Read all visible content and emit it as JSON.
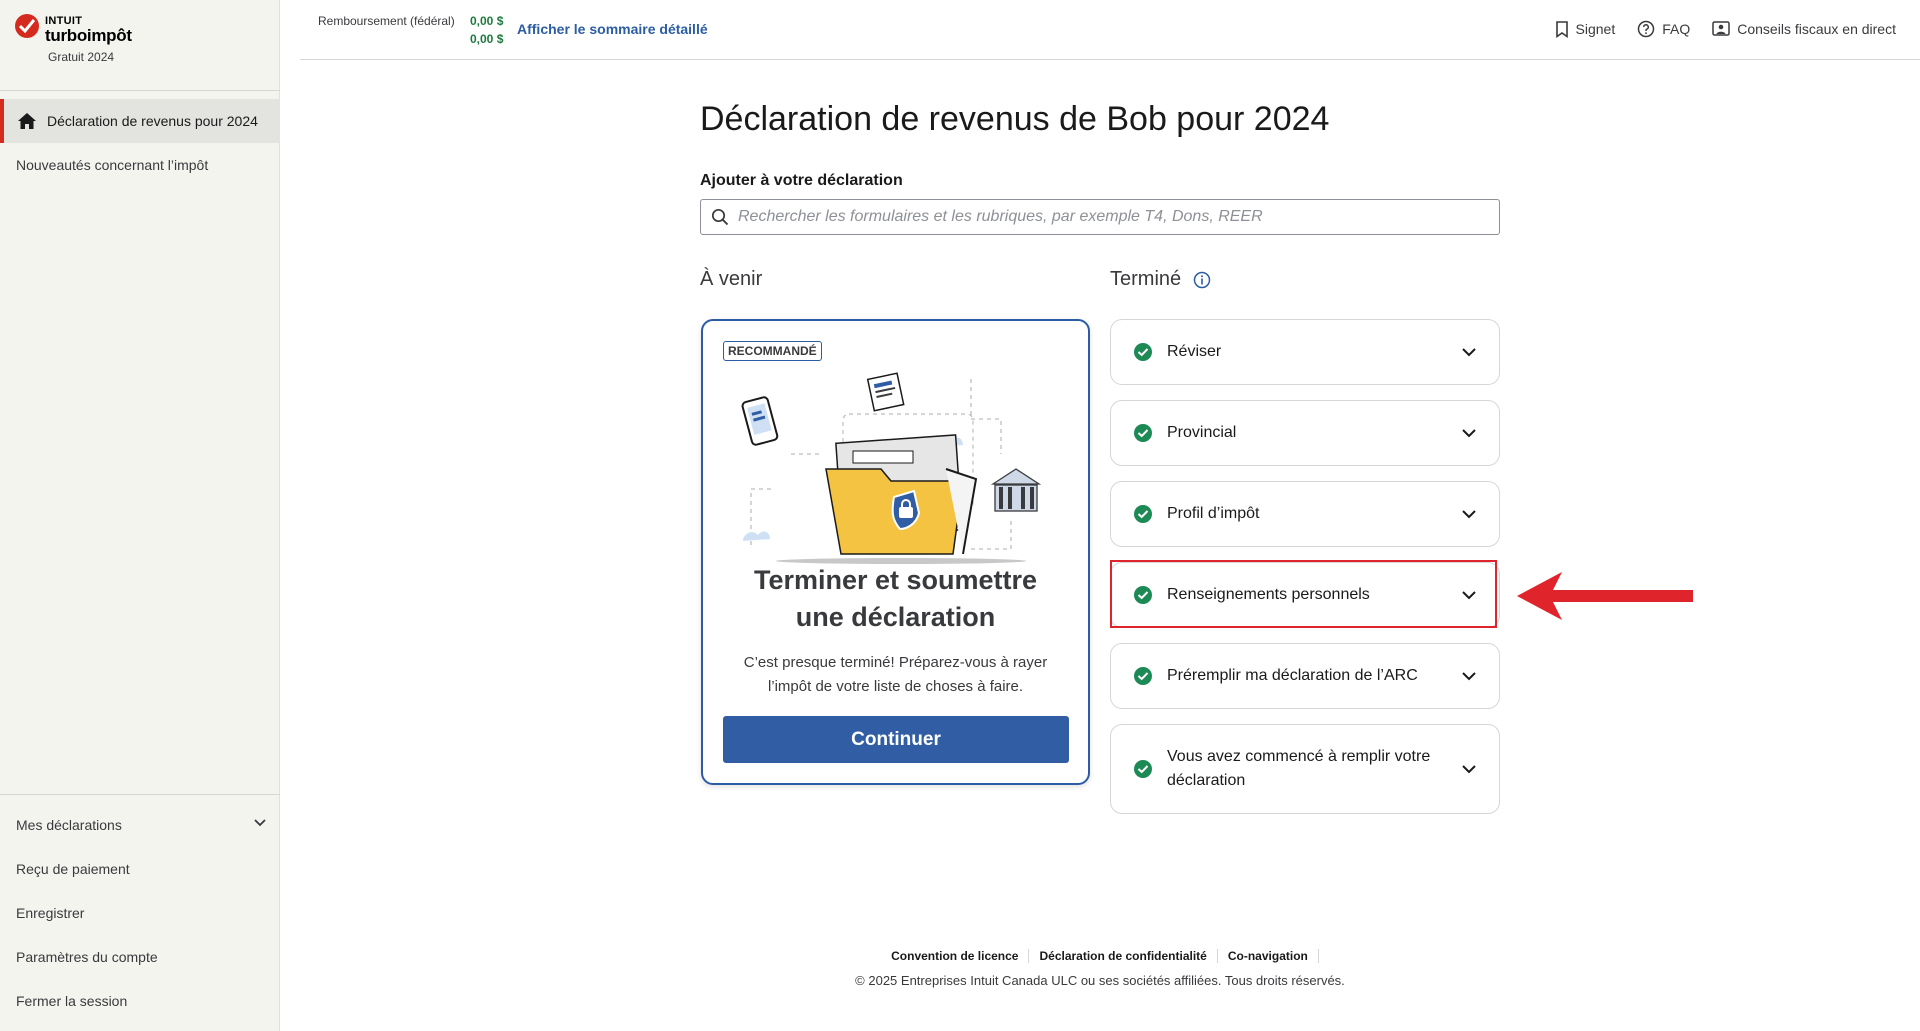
{
  "brand": {
    "intuit": "INTUIT",
    "product": "turboimpôt",
    "edition": "Gratuit 2024"
  },
  "sidebar": {
    "items": [
      {
        "label": "Déclaration de revenus pour 2024",
        "active": true,
        "icon": "home-icon"
      },
      {
        "label": "Nouveautés concernant l’impôt",
        "active": false
      }
    ],
    "bottom_items": [
      {
        "label": "Mes déclarations",
        "icon": "chevron-down-icon"
      },
      {
        "label": "Reçu de paiement"
      },
      {
        "label": "Enregistrer"
      },
      {
        "label": "Paramètres du compte"
      },
      {
        "label": "Fermer la session"
      }
    ]
  },
  "header": {
    "refund_label": "Remboursement (fédéral)",
    "refund_value_1": "0,00  $",
    "refund_value_2": "0,00  $",
    "summary_link": "Afficher le sommaire détaillé",
    "links": [
      {
        "label": "Signet",
        "icon": "bookmark-icon"
      },
      {
        "label": "FAQ",
        "icon": "question-icon"
      },
      {
        "label": "Conseils fiscaux en direct",
        "icon": "advisor-icon"
      }
    ]
  },
  "main": {
    "title": "Déclaration de revenus de Bob pour 2024",
    "add_label": "Ajouter à votre déclaration",
    "search_placeholder": "Rechercher les formulaires et les rubriques, par exemple T4, Dons, REER",
    "upcoming_heading": "À venir",
    "done_heading": "Terminé",
    "recommended": {
      "badge": "RECOMMANDÉ",
      "title_line1": "Terminer et soumettre",
      "title_line2": "une déclaration",
      "text": "C’est presque terminé! Préparez-vous à rayer l’impôt de votre liste de choses à faire.",
      "button": "Continuer"
    },
    "done_items": [
      {
        "label": "Réviser"
      },
      {
        "label": "Provincial"
      },
      {
        "label": "Profil d’impôt"
      },
      {
        "label": "Renseignements personnels",
        "highlighted": true
      },
      {
        "label": "Préremplir ma déclaration de l’ARC"
      },
      {
        "label": "Vous avez commencé à remplir votre déclaration"
      }
    ]
  },
  "footer": {
    "links": [
      "Convention de licence",
      "Déclaration de confidentialité",
      "Co-navigation"
    ],
    "copyright": "© 2025 Entreprises Intuit Canada ULC ou ses sociétés affiliées. Tous droits réservés."
  },
  "colors": {
    "accent_blue": "#305da3",
    "brand_red": "#d52b1e",
    "success_green": "#1d8a56",
    "annotation_red": "#e0242c"
  }
}
